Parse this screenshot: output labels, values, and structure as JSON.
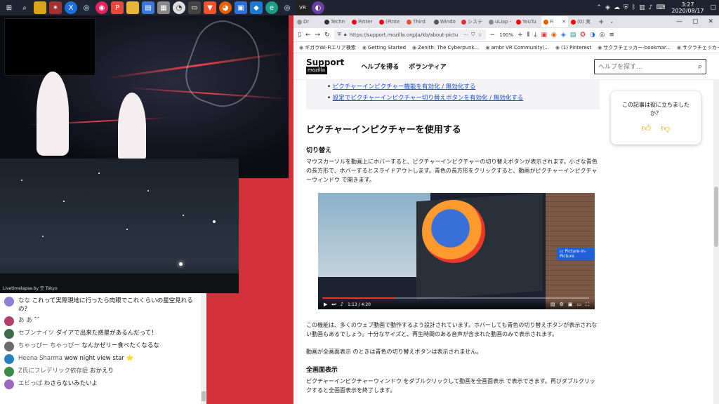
{
  "taskbar": {
    "clock_time": "3:27",
    "clock_date": "2020/08/17",
    "icons": [
      "windows-icon",
      "search-icon",
      "file-explorer-icon",
      "game-icon",
      "x-icon",
      "steam-icon",
      "app-icon",
      "app-icon",
      "folder-icon",
      "app-icon",
      "app-icon",
      "app-icon",
      "app-icon",
      "brave-icon",
      "firefox-icon",
      "app-icon",
      "cloud-icon",
      "edge-icon",
      "steam-icon",
      "vr-icon",
      "app-icon"
    ]
  },
  "stream": {
    "sky_caption": "Livetimelapse.by 空 Tokyo"
  },
  "chat": {
    "messages": [
      {
        "author": "なな",
        "text": "これって実際現地に行ったら肉眼でこれくらいの星空見れるの？",
        "avatar_color": "#8f7fcf"
      },
      {
        "author": "あ あ",
        "text": "ˆˆ",
        "avatar_color": "#b33f6b"
      },
      {
        "author": "セブンナイツ",
        "text": "ダイアで出来た惑星があるんだって！",
        "avatar_color": "#3c6b4a"
      },
      {
        "author": "ちゃっぴー ちゃっぴー",
        "text": "なんかゼリー食べたくなるな",
        "avatar_color": "#6a6a6a"
      },
      {
        "author": "Heena Sharma",
        "text": "wow night view star ⭐",
        "avatar_color": "#2a7fbf"
      },
      {
        "author": "Z氏にフレデリック依存症",
        "text": "おかえり",
        "avatar_color": "#3c8a4a"
      },
      {
        "author": "エビっぱ",
        "text": "わさらないみたいよ",
        "avatar_color": "#9a6ac0"
      }
    ]
  },
  "browser": {
    "tabs": [
      {
        "label": "Dr",
        "color": "#999"
      },
      {
        "label": "Techn",
        "color": "#333"
      },
      {
        "label": "Pinter",
        "color": "#e60023"
      },
      {
        "label": "(Pinte",
        "color": "#e60023"
      },
      {
        "label": "Third",
        "color": "#e8542b"
      },
      {
        "label": "Windo",
        "color": "#555"
      },
      {
        "label": "システ",
        "color": "#d33"
      },
      {
        "label": "uLisp - La",
        "color": "#888"
      },
      {
        "label": "YouTu",
        "color": "#f00"
      },
      {
        "label": "Fi",
        "color": "#e66000"
      },
      {
        "label": "(0) 実",
        "color": "#f00"
      }
    ],
    "url": "https://support.mozilla.org/ja/kb/about-pictu",
    "zoom": "100%",
    "bookmarks": [
      "ギガラWi-Fiエリア検索",
      "Getting Started",
      "Zenith: The Cyberpunk...",
      "ambr VR Community(...",
      "(1) Pinterest",
      "サクラチェッカー-bookmar...",
      "サクラチェッカーの使い方"
    ]
  },
  "site": {
    "logo_main": "Support",
    "logo_sub": "mozilla",
    "nav_help": "ヘルプを得る",
    "nav_volunteer": "ボランティア",
    "search_placeholder": "ヘルプを探す..."
  },
  "article": {
    "toc_links": [
      "ピクチャーインピクチャー機能を有効化 / 無効化する",
      "設定でピクチャーインピクチャー切り替えボタンを有効化 / 無効化する"
    ],
    "heading": "ピクチャーインピクチャーを使用する",
    "subheading_toggle": "切り替え",
    "para_toggle": "マウスカーソルを動画上にホバーすると、ピクチャーインピクチャーの切り替えボタンが表示されます。小さな青色の長方形で、ホバーするとスライドアウトします。青色の長方形をクリックすると、動画がピクチャーインピクチャーウィンドウ で開きます。",
    "pip_button_label": "Picture-in-Picture",
    "video_time": "1:13 / 4:20",
    "video_progress": 0.27,
    "para_compat": "この機能は、多くのウェブ動画で動作するよう設計されています。ホバーしても青色の切り替えボタンが表示されない動画もあるでしょう。十分なサイズと、再生時間のある音声が含まれた動画のみで表示されます。",
    "para_fullscreen_note": "動画が全画面表示 のときは青色の切り替えボタンは表示されません。",
    "subheading_fullscreen": "全画面表示",
    "para_fullscreen": "ピクチャーインピクチャーウィンドウ をダブルクリックして動画を全画面表示 で表示できます。再びダブルクリックすると全画面表示を終了します。"
  },
  "feedback": {
    "question": "この記事は役に立ちましたか？"
  }
}
